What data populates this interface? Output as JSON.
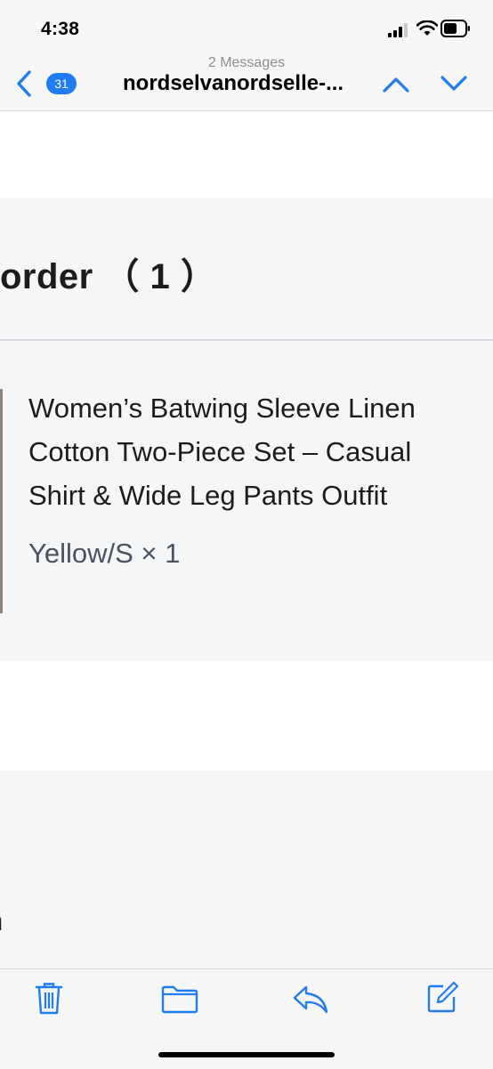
{
  "status_bar": {
    "time": "4:38"
  },
  "nav": {
    "back_badge": "31",
    "subtitle": "2 Messages",
    "title": "nordselvanordselle-..."
  },
  "order": {
    "heading": "order （ 1 ）",
    "item": {
      "name": "Women’s Batwing Sleeve Linen Cotton Two-Piece Set – Casual Shirt & Wide Leg Pants Outfit",
      "variant": "Yellow/S × 1"
    }
  },
  "cut_text": "n",
  "icons": {
    "back": "chevron-left-icon",
    "prev": "chevron-up-icon",
    "next": "chevron-down-icon",
    "trash": "trash-icon",
    "folder": "folder-icon",
    "reply": "reply-icon",
    "compose": "compose-icon"
  },
  "colors": {
    "accent": "#1f7cf5",
    "section_bg": "#f5f6f8"
  }
}
